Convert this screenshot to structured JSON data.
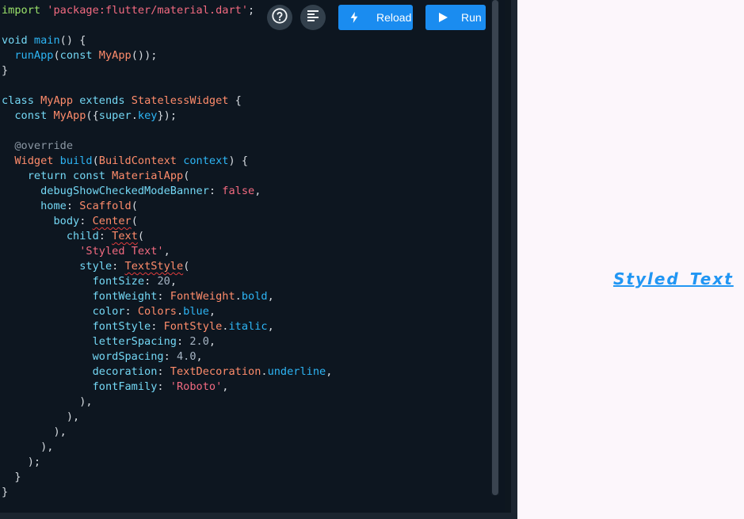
{
  "editor": {
    "code_lines": [
      [
        {
          "t": "import ",
          "c": "t-imp"
        },
        {
          "t": "'package:flutter/material.dart'",
          "c": "t-str"
        },
        {
          "t": ";",
          "c": "t-punc"
        }
      ],
      [],
      [
        {
          "t": "void ",
          "c": "t-kw"
        },
        {
          "t": "main",
          "c": "t-fn"
        },
        {
          "t": "() {",
          "c": "t-punc"
        }
      ],
      [
        {
          "t": "  ",
          "c": "t-plain"
        },
        {
          "t": "runApp",
          "c": "t-fn"
        },
        {
          "t": "(",
          "c": "t-punc"
        },
        {
          "t": "const ",
          "c": "t-kw"
        },
        {
          "t": "MyApp",
          "c": "t-type"
        },
        {
          "t": "());",
          "c": "t-punc"
        }
      ],
      [
        {
          "t": "}",
          "c": "t-punc"
        }
      ],
      [],
      [
        {
          "t": "class ",
          "c": "t-kw"
        },
        {
          "t": "MyApp ",
          "c": "t-type"
        },
        {
          "t": "extends ",
          "c": "t-kw"
        },
        {
          "t": "StatelessWidget",
          "c": "t-type"
        },
        {
          "t": " {",
          "c": "t-punc"
        }
      ],
      [
        {
          "t": "  ",
          "c": "t-plain"
        },
        {
          "t": "const ",
          "c": "t-kw"
        },
        {
          "t": "MyApp",
          "c": "t-type"
        },
        {
          "t": "({",
          "c": "t-punc"
        },
        {
          "t": "super",
          "c": "t-kw"
        },
        {
          "t": ".",
          "c": "t-punc"
        },
        {
          "t": "key",
          "c": "t-fn"
        },
        {
          "t": "});",
          "c": "t-punc"
        }
      ],
      [],
      [
        {
          "t": "  ",
          "c": "t-plain"
        },
        {
          "t": "@override",
          "c": "t-anno"
        }
      ],
      [
        {
          "t": "  ",
          "c": "t-plain"
        },
        {
          "t": "Widget ",
          "c": "t-type"
        },
        {
          "t": "build",
          "c": "t-fn"
        },
        {
          "t": "(",
          "c": "t-punc"
        },
        {
          "t": "BuildContext ",
          "c": "t-type"
        },
        {
          "t": "context",
          "c": "t-fn"
        },
        {
          "t": ") {",
          "c": "t-punc"
        }
      ],
      [
        {
          "t": "    ",
          "c": "t-plain"
        },
        {
          "t": "return ",
          "c": "t-kw"
        },
        {
          "t": "const ",
          "c": "t-kw"
        },
        {
          "t": "MaterialApp",
          "c": "t-type"
        },
        {
          "t": "(",
          "c": "t-punc"
        }
      ],
      [
        {
          "t": "      ",
          "c": "t-plain"
        },
        {
          "t": "debugShowCheckedModeBanner",
          "c": "t-kw"
        },
        {
          "t": ": ",
          "c": "t-punc"
        },
        {
          "t": "false",
          "c": "t-str"
        },
        {
          "t": ",",
          "c": "t-punc"
        }
      ],
      [
        {
          "t": "      ",
          "c": "t-plain"
        },
        {
          "t": "home",
          "c": "t-kw"
        },
        {
          "t": ": ",
          "c": "t-punc"
        },
        {
          "t": "Scaffold",
          "c": "t-type"
        },
        {
          "t": "(",
          "c": "t-punc"
        }
      ],
      [
        {
          "t": "        ",
          "c": "t-plain"
        },
        {
          "t": "body",
          "c": "t-kw"
        },
        {
          "t": ": ",
          "c": "t-punc"
        },
        {
          "t": "Center",
          "c": "t-type squiggle"
        },
        {
          "t": "(",
          "c": "t-punc"
        }
      ],
      [
        {
          "t": "          ",
          "c": "t-plain"
        },
        {
          "t": "child",
          "c": "t-kw"
        },
        {
          "t": ": ",
          "c": "t-punc"
        },
        {
          "t": "Text",
          "c": "t-type squiggle"
        },
        {
          "t": "(",
          "c": "t-punc"
        }
      ],
      [
        {
          "t": "            ",
          "c": "t-plain"
        },
        {
          "t": "'Styled Text'",
          "c": "t-str"
        },
        {
          "t": ",",
          "c": "t-punc"
        }
      ],
      [
        {
          "t": "            ",
          "c": "t-plain"
        },
        {
          "t": "style",
          "c": "t-kw"
        },
        {
          "t": ": ",
          "c": "t-punc"
        },
        {
          "t": "TextStyle",
          "c": "t-type squiggle"
        },
        {
          "t": "(",
          "c": "t-punc"
        }
      ],
      [
        {
          "t": "              ",
          "c": "t-plain"
        },
        {
          "t": "fontSize",
          "c": "t-kw"
        },
        {
          "t": ": ",
          "c": "t-punc"
        },
        {
          "t": "20",
          "c": "t-num"
        },
        {
          "t": ",",
          "c": "t-punc"
        }
      ],
      [
        {
          "t": "              ",
          "c": "t-plain"
        },
        {
          "t": "fontWeight",
          "c": "t-kw"
        },
        {
          "t": ": ",
          "c": "t-punc"
        },
        {
          "t": "FontWeight",
          "c": "t-type"
        },
        {
          "t": ".",
          "c": "t-punc"
        },
        {
          "t": "bold",
          "c": "t-fn"
        },
        {
          "t": ",",
          "c": "t-punc"
        }
      ],
      [
        {
          "t": "              ",
          "c": "t-plain"
        },
        {
          "t": "color",
          "c": "t-kw"
        },
        {
          "t": ": ",
          "c": "t-punc"
        },
        {
          "t": "Colors",
          "c": "t-type"
        },
        {
          "t": ".",
          "c": "t-punc"
        },
        {
          "t": "blue",
          "c": "t-fn"
        },
        {
          "t": ",",
          "c": "t-punc"
        }
      ],
      [
        {
          "t": "              ",
          "c": "t-plain"
        },
        {
          "t": "fontStyle",
          "c": "t-kw"
        },
        {
          "t": ": ",
          "c": "t-punc"
        },
        {
          "t": "FontStyle",
          "c": "t-type"
        },
        {
          "t": ".",
          "c": "t-punc"
        },
        {
          "t": "italic",
          "c": "t-fn"
        },
        {
          "t": ",",
          "c": "t-punc"
        }
      ],
      [
        {
          "t": "              ",
          "c": "t-plain"
        },
        {
          "t": "letterSpacing",
          "c": "t-kw"
        },
        {
          "t": ": ",
          "c": "t-punc"
        },
        {
          "t": "2.0",
          "c": "t-num"
        },
        {
          "t": ",",
          "c": "t-punc"
        }
      ],
      [
        {
          "t": "              ",
          "c": "t-plain"
        },
        {
          "t": "wordSpacing",
          "c": "t-kw"
        },
        {
          "t": ": ",
          "c": "t-punc"
        },
        {
          "t": "4.0",
          "c": "t-num"
        },
        {
          "t": ",",
          "c": "t-punc"
        }
      ],
      [
        {
          "t": "              ",
          "c": "t-plain"
        },
        {
          "t": "decoration",
          "c": "t-kw"
        },
        {
          "t": ": ",
          "c": "t-punc"
        },
        {
          "t": "TextDecoration",
          "c": "t-type"
        },
        {
          "t": ".",
          "c": "t-punc"
        },
        {
          "t": "underline",
          "c": "t-fn"
        },
        {
          "t": ",",
          "c": "t-punc"
        }
      ],
      [
        {
          "t": "              ",
          "c": "t-plain"
        },
        {
          "t": "fontFamily",
          "c": "t-kw"
        },
        {
          "t": ": ",
          "c": "t-punc"
        },
        {
          "t": "'Roboto'",
          "c": "t-str"
        },
        {
          "t": ",",
          "c": "t-punc"
        }
      ],
      [
        {
          "t": "            ),",
          "c": "t-punc"
        }
      ],
      [
        {
          "t": "          ),",
          "c": "t-punc"
        }
      ],
      [
        {
          "t": "        ),",
          "c": "t-punc"
        }
      ],
      [
        {
          "t": "      ),",
          "c": "t-punc"
        }
      ],
      [
        {
          "t": "    );",
          "c": "t-punc"
        }
      ],
      [
        {
          "t": "  }",
          "c": "t-punc"
        }
      ],
      [
        {
          "t": "}",
          "c": "t-punc"
        }
      ]
    ]
  },
  "toolbar": {
    "help_icon": "help-circle-icon",
    "format_icon": "format-align-icon",
    "reload_label": "Reload",
    "reload_icon": "lightning-bolt-icon",
    "run_label": "Run",
    "run_icon": "play-icon",
    "accent_color": "#1a8cf0"
  },
  "preview": {
    "output_text": "Styled Text",
    "text_color": "#2196f3",
    "background": "#fcf6fb"
  }
}
